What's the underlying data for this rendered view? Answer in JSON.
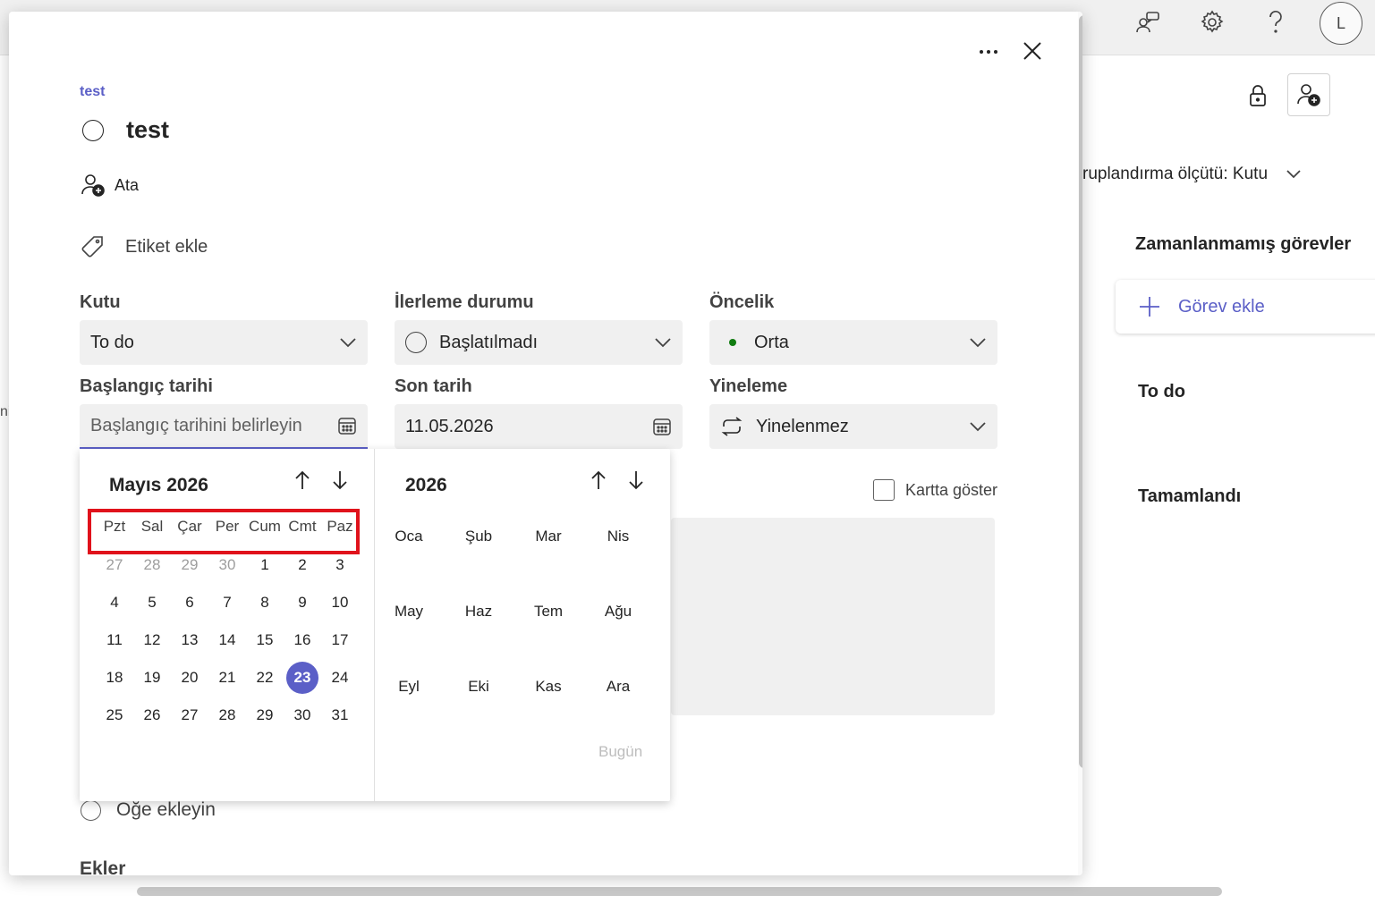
{
  "app": {
    "group_by_label": "ruplandırma ölçütü: Kutu",
    "buckets": [
      "Zamanlanmamış görevler",
      "To do",
      "Tamamlandı"
    ],
    "add_task_label": "Görev ekle",
    "avatar_initial": "L",
    "left_edge_fragment": "ni"
  },
  "task": {
    "plan_name": "test",
    "title": "test",
    "assign_label": "Ata",
    "add_label_text": "Etiket ekle",
    "fields": {
      "bucket": {
        "label": "Kutu",
        "value": "To do"
      },
      "progress": {
        "label": "İlerleme durumu",
        "value": "Başlatılmadı"
      },
      "priority": {
        "label": "Öncelik",
        "value": "Orta",
        "dot_color": "#107c10"
      },
      "start": {
        "label": "Başlangıç tarihi",
        "placeholder": "Başlangıç tarihini belirleyin"
      },
      "due": {
        "label": "Son tarih",
        "value": "11.05.2026"
      },
      "repeat": {
        "label": "Yineleme",
        "value": "Yinelenmez"
      }
    },
    "show_on_card_label": "Kartta göster",
    "add_item_label": "Öğe ekleyin",
    "attachments_label": "Ekler"
  },
  "datepicker": {
    "month_label": "Mayıs 2026",
    "weekdays": [
      "Pzt",
      "Sal",
      "Çar",
      "Per",
      "Cum",
      "Cmt",
      "Paz"
    ],
    "weeks": [
      [
        "27",
        "28",
        "29",
        "30",
        "1",
        "2",
        "3"
      ],
      [
        "4",
        "5",
        "6",
        "7",
        "8",
        "9",
        "10"
      ],
      [
        "11",
        "12",
        "13",
        "14",
        "15",
        "16",
        "17"
      ],
      [
        "18",
        "19",
        "20",
        "21",
        "22",
        "23",
        "24"
      ],
      [
        "25",
        "26",
        "27",
        "28",
        "29",
        "30",
        "31"
      ]
    ],
    "previous_month_days": [
      "27",
      "28",
      "29",
      "30"
    ],
    "selected_day": "23",
    "year_label": "2026",
    "months": [
      "Oca",
      "Şub",
      "Mar",
      "Nis",
      "May",
      "Haz",
      "Tem",
      "Ağu",
      "Eyl",
      "Eki",
      "Kas",
      "Ara"
    ],
    "today_label": "Bugün",
    "highlight_color": "#e0121b",
    "accent_color": "#5b5fc7"
  }
}
